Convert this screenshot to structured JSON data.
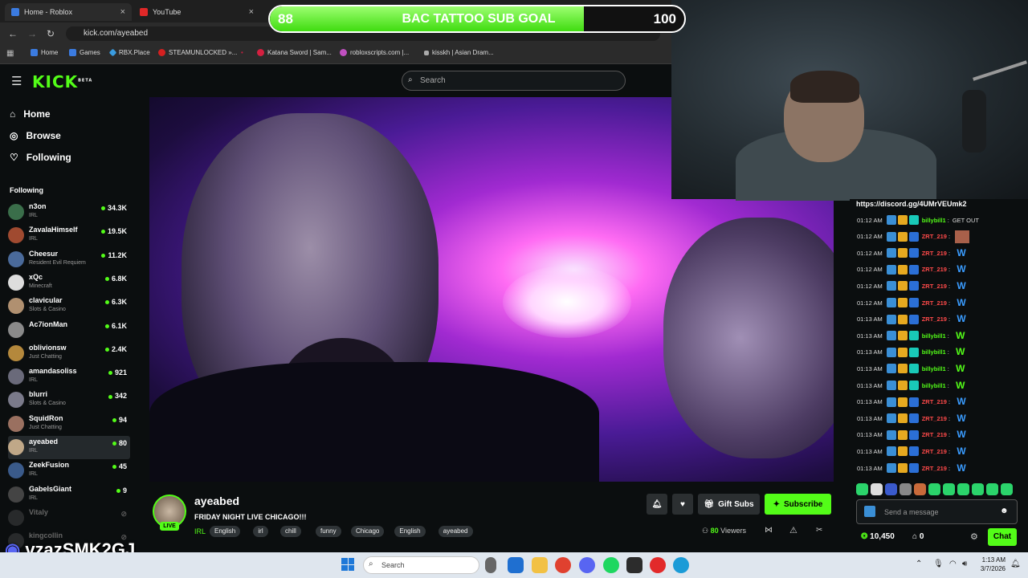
{
  "browser": {
    "tabs": [
      {
        "label": "Home - Roblox",
        "close": "×"
      },
      {
        "label": "YouTube",
        "close": "×"
      }
    ],
    "url": "kick.com/ayeabed",
    "bookmarks": [
      "Home",
      "Games",
      "RBX.Place",
      "STEAMUNLOCKED »...",
      "Katana Sword | Sam...",
      "robloxscripts.com |...",
      "kisskh | Asian Dram..."
    ]
  },
  "header": {
    "logo": "KICK",
    "beta": "BETA",
    "search_placeholder": "Search"
  },
  "sidebar": {
    "nav": [
      {
        "label": "Home",
        "icon": "home-icon"
      },
      {
        "label": "Browse",
        "icon": "compass-icon"
      },
      {
        "label": "Following",
        "icon": "heart-icon"
      }
    ],
    "following_title": "Following",
    "items": [
      {
        "name": "n3on",
        "category": "IRL",
        "viewers": "34.3K",
        "color": "#3a6e4a"
      },
      {
        "name": "ZavalaHimself",
        "category": "IRL",
        "viewers": "19.5K",
        "color": "#a04a30"
      },
      {
        "name": "Cheesur",
        "category": "Resident Evil Requiem",
        "viewers": "11.2K",
        "color": "#4a6a9a"
      },
      {
        "name": "xQc",
        "category": "Minecraft",
        "viewers": "6.8K",
        "color": "#dddddd"
      },
      {
        "name": "clavicular",
        "category": "Slots & Casino",
        "viewers": "6.3K",
        "color": "#b09070"
      },
      {
        "name": "Ac7ionMan",
        "category": "",
        "viewers": "6.1K",
        "color": "#8a8a8a"
      },
      {
        "name": "oblivionsw",
        "category": "Just Chatting",
        "viewers": "2.4K",
        "color": "#b4883c"
      },
      {
        "name": "amandasoliss",
        "category": "IRL",
        "viewers": "921",
        "color": "#6a6a7a"
      },
      {
        "name": "blurri",
        "category": "Slots & Casino",
        "viewers": "342",
        "color": "#7a7a8a"
      },
      {
        "name": "SquidRon",
        "category": "Just Chatting",
        "viewers": "94",
        "color": "#9a7060"
      },
      {
        "name": "ayeabed",
        "category": "IRL",
        "viewers": "80",
        "color": "#c0a888"
      },
      {
        "name": "ZeekFusion",
        "category": "IRL",
        "viewers": "45",
        "color": "#3a5a8a"
      },
      {
        "name": "GabelsGiant",
        "category": "IRL",
        "viewers": "9",
        "color": "#444444"
      },
      {
        "name": "Vitaly",
        "category": "",
        "viewers": "",
        "color": "#555555"
      },
      {
        "name": "kingcollin",
        "category": "",
        "viewers": "",
        "color": "#555555"
      }
    ]
  },
  "goal": {
    "current": "88",
    "target": "100",
    "title": "BAC TATTOO SUB GOAL",
    "progress": 0.88
  },
  "channel": {
    "name": "ayeabed",
    "live": "LIVE",
    "title": "FRIDAY NIGHT LIVE CHICAGO!!!",
    "category": "IRL",
    "tags": [
      "English",
      "irl",
      "chill",
      "funny",
      "Chicago",
      "English",
      "ayeabed"
    ],
    "gift_label": "Gift Subs",
    "subscribe_label": "Subscribe",
    "viewer_count": "80",
    "viewers_label": "Viewers"
  },
  "chat": {
    "pinned_link": "https://discord.gg/4UMrVEUmk2",
    "messages": [
      {
        "time": "01:12 AM",
        "user": "billybill1",
        "text": "GET OUT",
        "color": "#53fc18",
        "emote": ""
      },
      {
        "time": "01:12 AM",
        "user": "ZRT_219",
        "text": "",
        "color": "#ff4a4a",
        "emote": "img"
      },
      {
        "time": "01:12 AM",
        "user": "ZRT_219",
        "text": "",
        "color": "#ff4a4a",
        "emote": "W"
      },
      {
        "time": "01:12 AM",
        "user": "ZRT_219",
        "text": "",
        "color": "#ff4a4a",
        "emote": "W"
      },
      {
        "time": "01:12 AM",
        "user": "ZRT_219",
        "text": "",
        "color": "#ff4a4a",
        "emote": "W"
      },
      {
        "time": "01:12 AM",
        "user": "ZRT_219",
        "text": "",
        "color": "#ff4a4a",
        "emote": "W"
      },
      {
        "time": "01:13 AM",
        "user": "ZRT_219",
        "text": "",
        "color": "#ff4a4a",
        "emote": "W"
      },
      {
        "time": "01:13 AM",
        "user": "billybill1",
        "text": "",
        "color": "#53fc18",
        "emote": "W"
      },
      {
        "time": "01:13 AM",
        "user": "billybill1",
        "text": "",
        "color": "#53fc18",
        "emote": "W"
      },
      {
        "time": "01:13 AM",
        "user": "billybill1",
        "text": "",
        "color": "#53fc18",
        "emote": "W"
      },
      {
        "time": "01:13 AM",
        "user": "billybill1",
        "text": "",
        "color": "#53fc18",
        "emote": "W"
      },
      {
        "time": "01:13 AM",
        "user": "ZRT_219",
        "text": "",
        "color": "#ff4a4a",
        "emote": "W"
      },
      {
        "time": "01:13 AM",
        "user": "ZRT_219",
        "text": "",
        "color": "#ff4a4a",
        "emote": "W"
      },
      {
        "time": "01:13 AM",
        "user": "ZRT_219",
        "text": "",
        "color": "#ff4a4a",
        "emote": "W"
      },
      {
        "time": "01:13 AM",
        "user": "ZRT_219",
        "text": "",
        "color": "#ff4a4a",
        "emote": "W"
      },
      {
        "time": "01:13 AM",
        "user": "ZRT_219",
        "text": "",
        "color": "#ff4a4a",
        "emote": "W"
      }
    ],
    "input_placeholder": "Send a message",
    "points": "10,450",
    "points2": "0",
    "chat_button": "Chat"
  },
  "overlay": {
    "streamer_tag": "vzazSMK2GJ"
  },
  "taskbar": {
    "search": "Search",
    "time": "1:13 AM",
    "date": "3/7/2026"
  },
  "colors": {
    "accent": "#53fc18",
    "bg": "#0b0e0f"
  }
}
